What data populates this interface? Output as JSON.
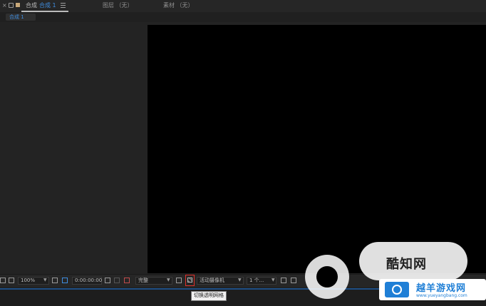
{
  "tabs": {
    "close": "×",
    "composition_prefix": "合成",
    "composition_name": "合成 1",
    "layer_panel": "图层 （无）",
    "footage_panel": "素材 （无）"
  },
  "breadcrumb": "合成 1",
  "toolbar": {
    "zoom": "100%",
    "timecode": "0:00:00:00",
    "resolution": "完整",
    "camera": "活动摄像机",
    "views": "1 个..."
  },
  "tooltip": "切换透明网格",
  "watermark": {
    "main": "酷知网",
    "secondary": "越羊游戏网",
    "url": "www.yueyangbang.com"
  },
  "colors": {
    "accent": "#3f8ee0",
    "highlight_box": "#e0302a",
    "canvas": "#000000",
    "panel": "#232323"
  }
}
